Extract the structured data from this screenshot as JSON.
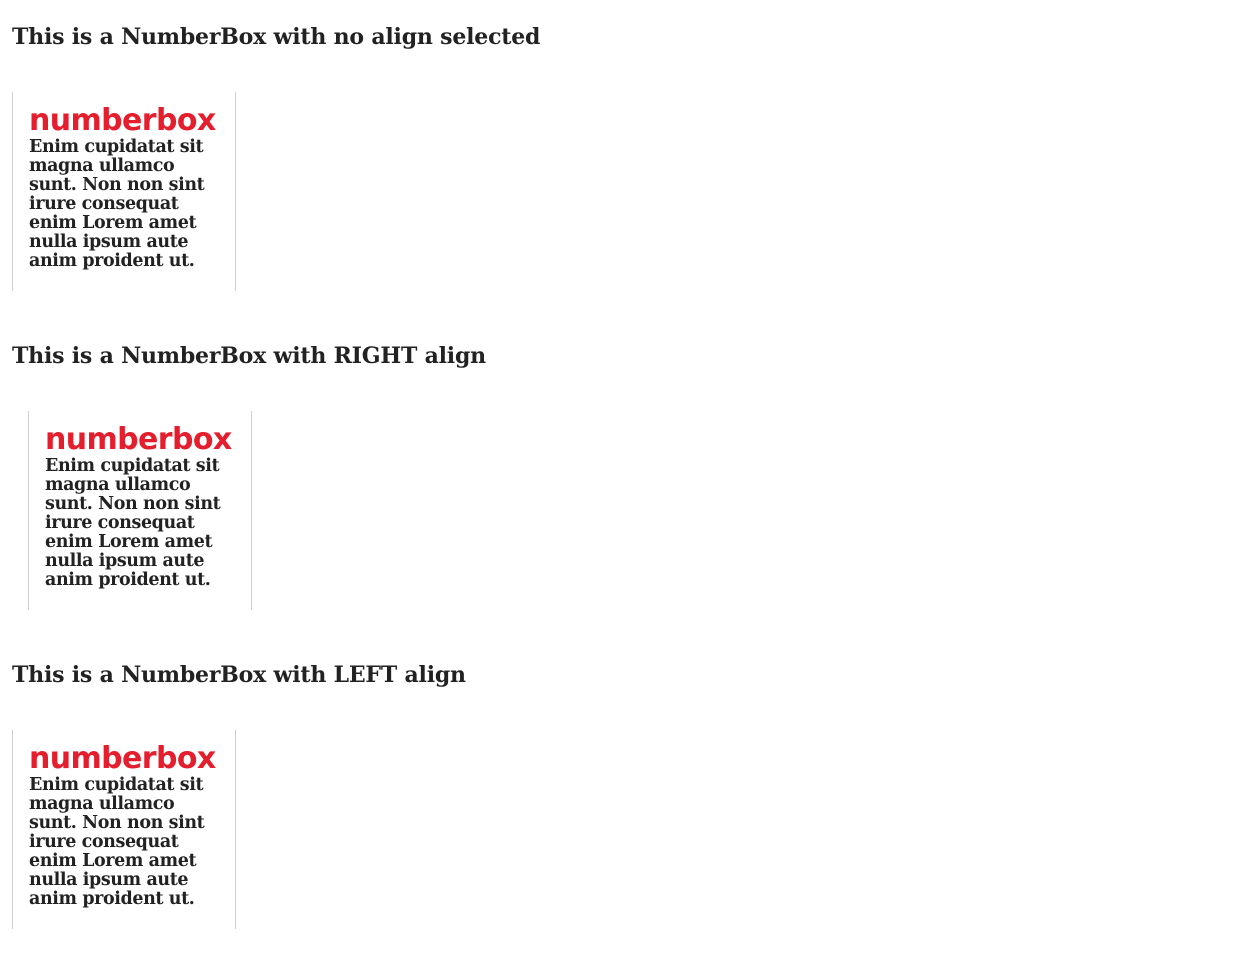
{
  "sections": [
    {
      "heading": "This is a NumberBox with no align selected",
      "box": {
        "title": "numberbox",
        "body": "Enim cupidatat sit magna ullamco sunt. Non non sint irure consequat enim Lorem amet nulla ipsum aute anim proident ut."
      }
    },
    {
      "heading": "This is a NumberBox with RIGHT align",
      "box": {
        "title": "numberbox",
        "body": "Enim cupidatat sit magna ullamco sunt. Non non sint irure consequat enim Lorem amet nulla ipsum aute anim proident ut."
      }
    },
    {
      "heading": "This is a NumberBox with LEFT align",
      "box": {
        "title": "numberbox",
        "body": "Enim cupidatat sit magna ullamco sunt. Non non sint irure consequat enim Lorem amet nulla ipsum aute anim proident ut."
      }
    }
  ],
  "colors": {
    "title_red": "#e41e2d",
    "text": "#222222",
    "border": "#cfcfcf"
  }
}
